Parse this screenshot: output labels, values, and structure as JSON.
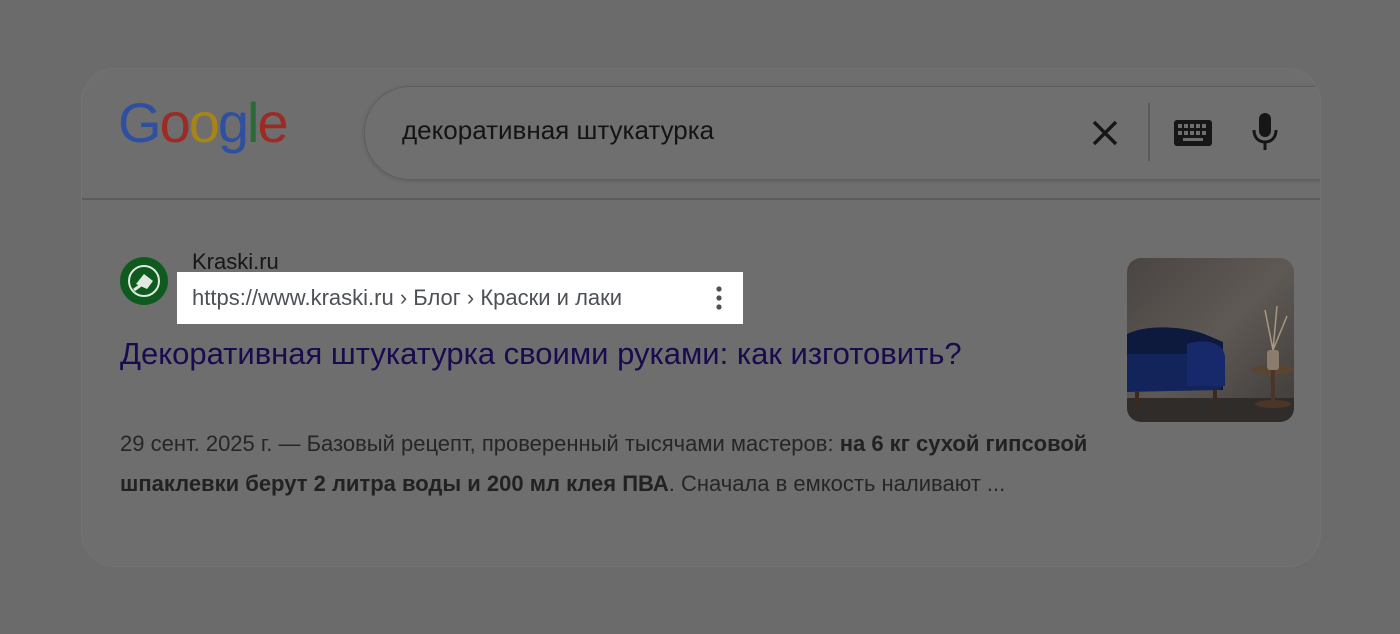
{
  "logo": {
    "letters": [
      {
        "char": "G",
        "color": "#2f4fa0"
      },
      {
        "char": "o",
        "color": "#9b2b23"
      },
      {
        "char": "o",
        "color": "#a68416"
      },
      {
        "char": "g",
        "color": "#2f4fa0"
      },
      {
        "char": "l",
        "color": "#2a6a36"
      },
      {
        "char": "e",
        "color": "#9b2b23"
      }
    ]
  },
  "search": {
    "query": "декоративная штукатурка",
    "icons": [
      "close-icon",
      "keyboard-icon",
      "mic-icon"
    ]
  },
  "result": {
    "site_name": "Kraski.ru",
    "url": "https://www.kraski.ru › Блог › Краски и лаки",
    "title": "Декоративная штукатурка своими руками: как изготовить?",
    "snippet": {
      "date": "29 сент. 2025 г.",
      "separator": " — ",
      "lead": "Базовый рецепт, проверенный тысячами мастеров: ",
      "bold": "на 6 кг сухой гипсовой шпаклевки берут 2 литра воды и 200 мл клея ПВА",
      "tail": ". Сначала в емкость наливают ..."
    },
    "favicon": "kraski-logo-icon",
    "thumbnail": "blue-armchair-image"
  },
  "colors": {
    "overlay": "#6b6b6b",
    "highlight": "#ffffff",
    "title_link": "#1a0a4e",
    "favicon_bg": "#0f5a1e"
  }
}
